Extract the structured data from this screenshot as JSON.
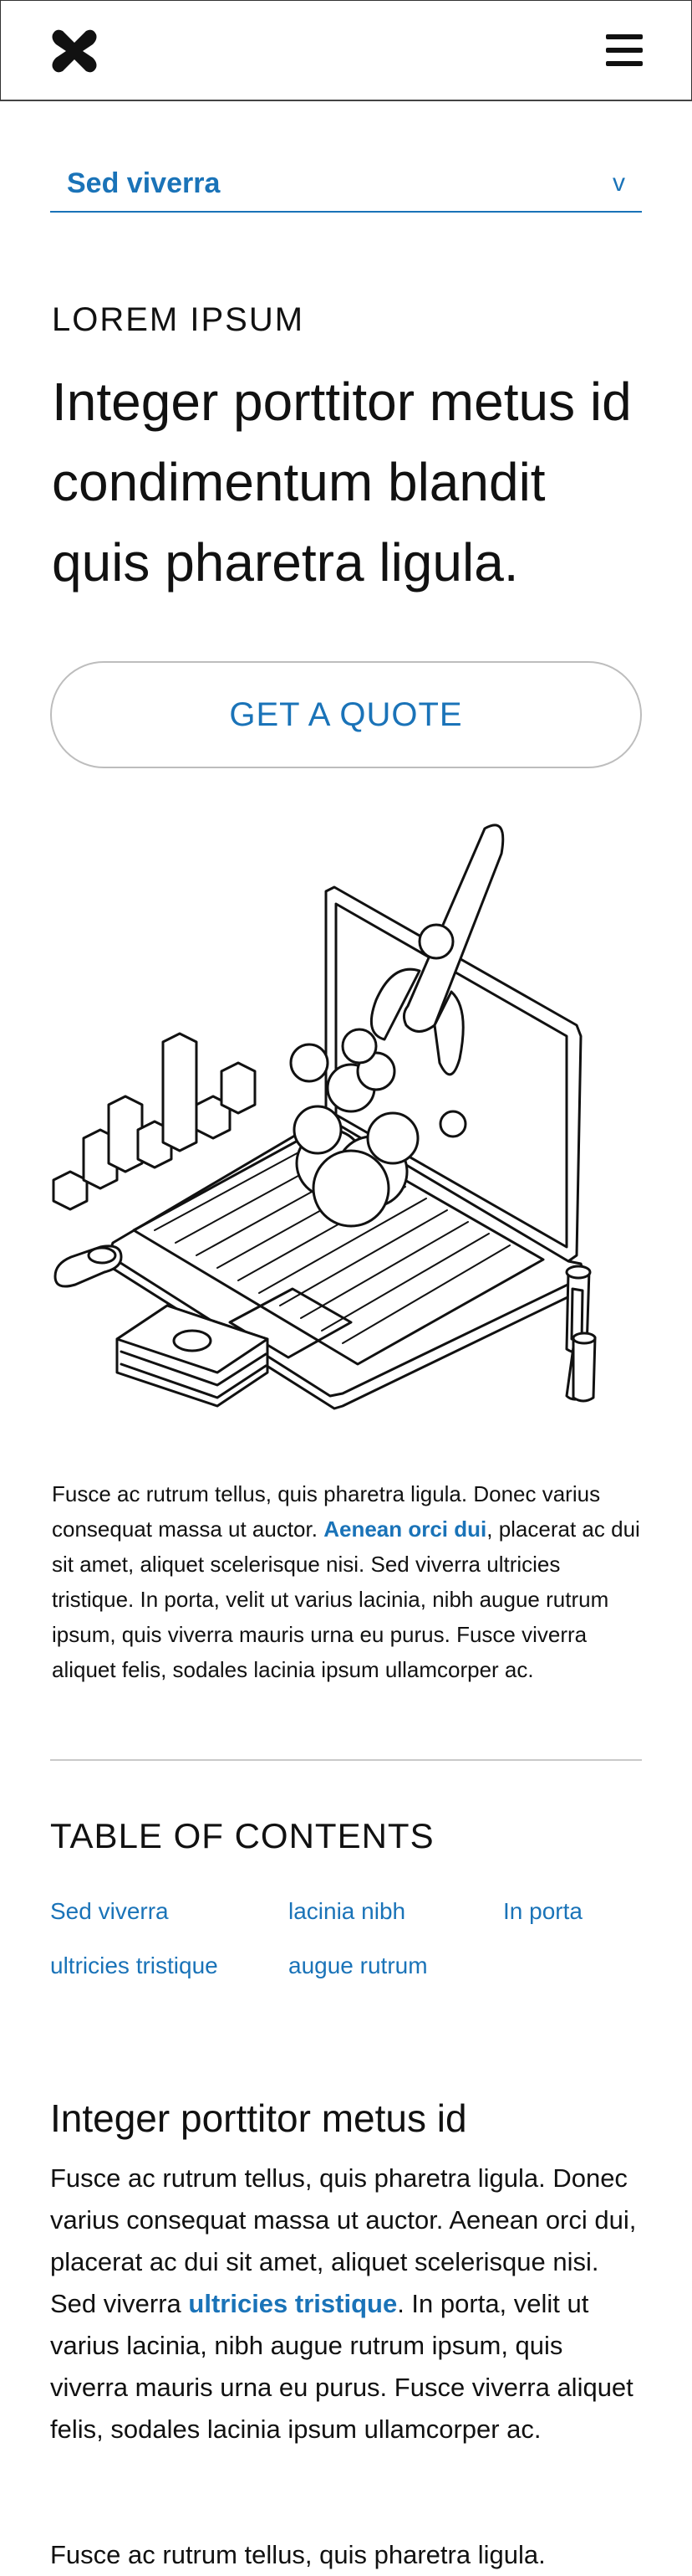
{
  "header": {
    "logo_icon": "x-logo-icon",
    "menu_icon": "hamburger-menu-icon"
  },
  "dropdown": {
    "selected": "Sed viverra",
    "chevron": "v"
  },
  "hero": {
    "eyebrow": "LOREM IPSUM",
    "headline": "Integer porttitor metus id condimentum blandit quis pharetra ligula.",
    "cta": "GET A QUOTE"
  },
  "illustration": {
    "icon": "laptop-rocket-growth-illustration"
  },
  "intro": {
    "text_before": "Fusce ac rutrum tellus, quis pharetra ligula. Donec varius consequat massa ut auctor. ",
    "link": "Aenean orci dui",
    "text_after": ", placerat ac dui sit amet, aliquet scelerisque nisi. Sed viverra ultricies tristique. In porta, velit ut varius lacinia, nibh augue rutrum ipsum, quis viverra mauris urna eu purus. Fusce viverra aliquet felis, sodales lacinia ipsum ullamcorper ac."
  },
  "toc": {
    "title": "TABLE OF CONTENTS",
    "links": [
      "Sed viverra",
      "lacinia nibh",
      "In porta",
      "ultricies tristique",
      "augue rutrum"
    ]
  },
  "section": {
    "title": "Integer porttitor metus id",
    "p1_before": "Fusce ac rutrum tellus, quis pharetra ligula. Donec varius consequat massa ut auctor. Aenean orci dui, placerat ac dui sit amet, aliquet scelerisque nisi. Sed viverra ",
    "p1_link": "ultricies tristique",
    "p1_after": ". In porta, velit ut varius lacinia, nibh augue rutrum ipsum, quis viverra mauris urna eu purus. Fusce viverra aliquet felis, sodales lacinia ipsum ullamcorper ac.",
    "p2": "Fusce ac rutrum tellus, quis pharetra ligula."
  },
  "colors": {
    "accent": "#1a73b8",
    "text": "#111111",
    "divider": "#c9c9c9"
  }
}
